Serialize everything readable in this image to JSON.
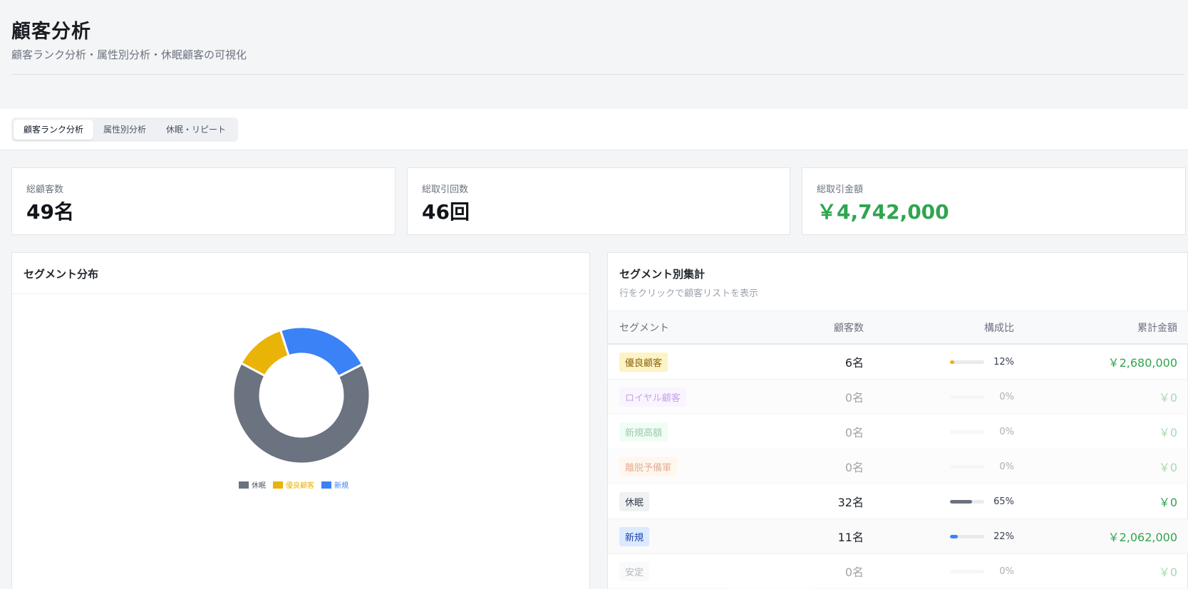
{
  "header": {
    "title": "顧客分析",
    "subtitle": "顧客ランク分析・属性別分析・休眠顧客の可視化"
  },
  "tabs": [
    {
      "label": "顧客ランク分析",
      "active": true
    },
    {
      "label": "属性別分析",
      "active": false
    },
    {
      "label": "休眠・リピート",
      "active": false
    }
  ],
  "stats": [
    {
      "label": "総顧客数",
      "value": "49名"
    },
    {
      "label": "総取引回数",
      "value": "46回"
    },
    {
      "label": "総取引金額",
      "value": "￥4,742,000"
    }
  ],
  "distribution": {
    "title": "セグメント分布"
  },
  "chart_data": {
    "type": "pie",
    "donut": true,
    "categories": [
      "休眠",
      "優良顧客",
      "新規"
    ],
    "values": [
      32,
      6,
      11
    ],
    "colors": [
      "#6b7280",
      "#eab308",
      "#3b82f6"
    ],
    "legend": "bottom"
  },
  "summary": {
    "title": "セグメント別集計",
    "subtitle": "行をクリックで顧客リストを表示",
    "columns": [
      "セグメント",
      "顧客数",
      "構成比",
      "累計金額"
    ],
    "rows": [
      {
        "segment": "優良顧客",
        "count": "6名",
        "ratio": 12,
        "ratio_text": "12%",
        "amount": "￥2,680,000",
        "badge_bg": "#fdf3c4",
        "badge_fg": "#8a6410",
        "bar_color": "#eab308"
      },
      {
        "segment": "ロイヤル顧客",
        "count": "0名",
        "ratio": 0,
        "ratio_text": "0%",
        "amount": "￥0",
        "badge_bg": "#f3e8ff",
        "badge_fg": "#7e22ce",
        "bar_color": "#a855f7"
      },
      {
        "segment": "新規高額",
        "count": "0名",
        "ratio": 0,
        "ratio_text": "0%",
        "amount": "￥0",
        "badge_bg": "#dcfce7",
        "badge_fg": "#15803d",
        "bar_color": "#22c55e"
      },
      {
        "segment": "離脱予備軍",
        "count": "0名",
        "ratio": 0,
        "ratio_text": "0%",
        "amount": "￥0",
        "badge_bg": "#ffedd5",
        "badge_fg": "#c2410c",
        "bar_color": "#f97316"
      },
      {
        "segment": "休眠",
        "count": "32名",
        "ratio": 65,
        "ratio_text": "65%",
        "amount": "￥0",
        "badge_bg": "#f0f1f3",
        "badge_fg": "#374151",
        "bar_color": "#6b7280"
      },
      {
        "segment": "新規",
        "count": "11名",
        "ratio": 22,
        "ratio_text": "22%",
        "amount": "￥2,062,000",
        "badge_bg": "#dbeafe",
        "badge_fg": "#1e40af",
        "bar_color": "#3b82f6"
      },
      {
        "segment": "安定",
        "count": "0名",
        "ratio": 0,
        "ratio_text": "0%",
        "amount": "￥0",
        "badge_bg": "#f3f4f6",
        "badge_fg": "#4b5563",
        "bar_color": "#9ca3af"
      }
    ]
  }
}
